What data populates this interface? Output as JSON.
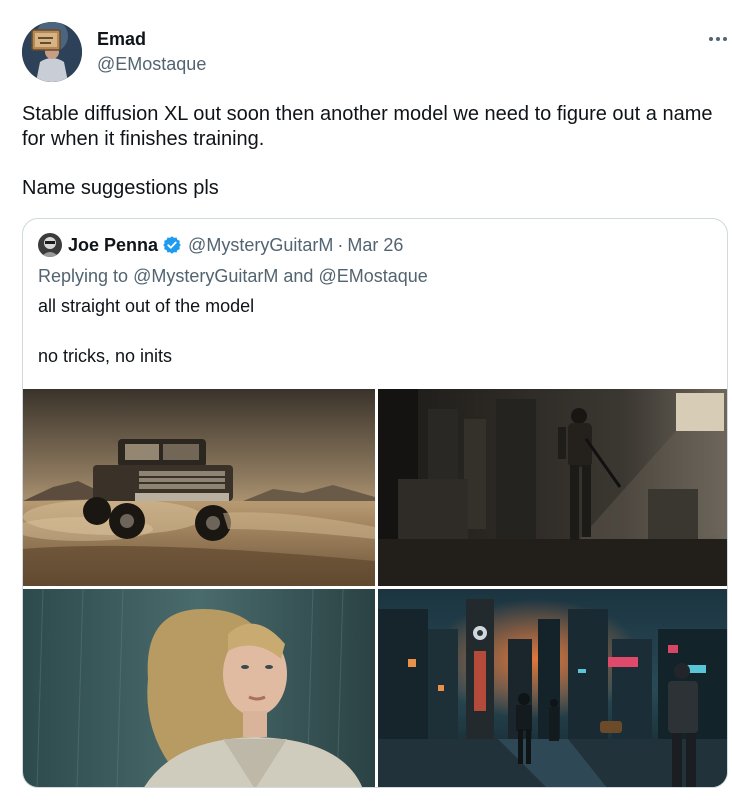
{
  "tweet": {
    "author": {
      "name": "Emad",
      "handle": "@EMostaque"
    },
    "text_lines": [
      "Stable diffusion XL out soon then another model we need to figure out a name for when it finishes training.",
      "Name suggestions pls"
    ],
    "more_label": "•••"
  },
  "quote": {
    "author": {
      "name": "Joe Penna",
      "handle": "@MysteryGuitarM",
      "separator": "·",
      "date": "Mar 26"
    },
    "reply": {
      "prefix": "Replying to",
      "mention_1": "@MysteryGuitarM",
      "conjunction": "and",
      "mention_2": "@EMostaque"
    },
    "text_lines": [
      "all straight out of the model",
      "no tricks, no inits"
    ],
    "media": [
      {
        "subject": "pickup truck in desert"
      },
      {
        "subject": "soldier in abandoned factory"
      },
      {
        "subject": "blonde woman portrait"
      },
      {
        "subject": "neon cyberpunk city street"
      }
    ]
  },
  "colors": {
    "text": "#0f1419",
    "muted": "#536471",
    "border": "#cfd9de",
    "verified": "#1d9bf0"
  }
}
